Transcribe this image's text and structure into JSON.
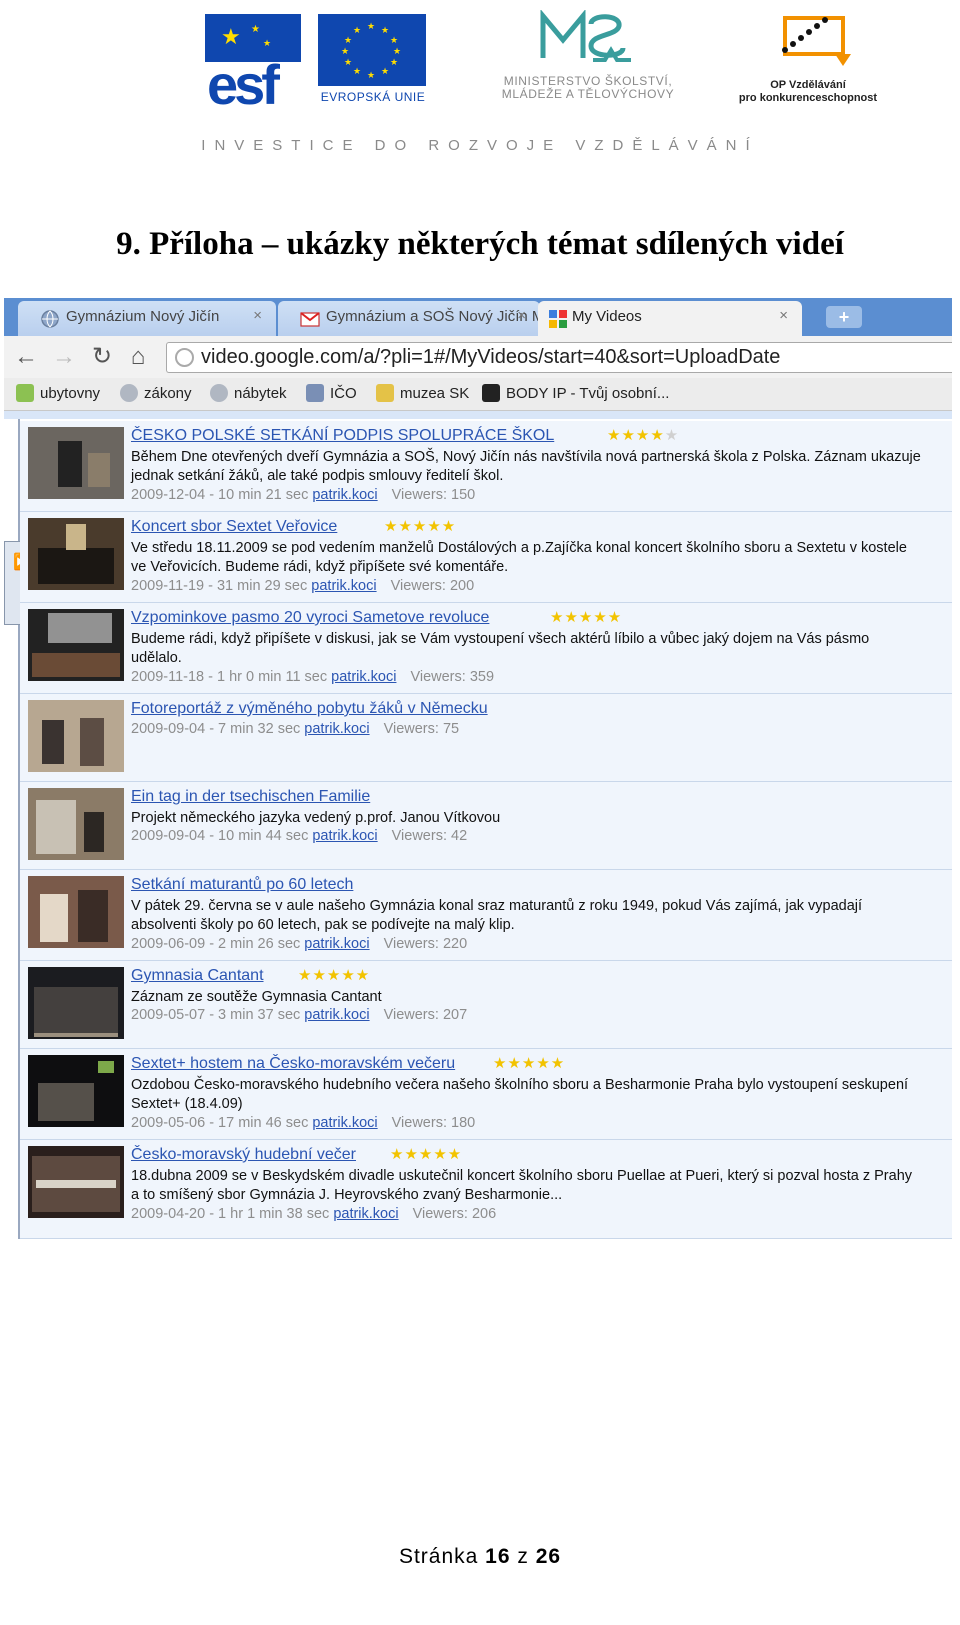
{
  "header": {
    "esf_logo_text": "esf",
    "eu_label": "EVROPSKÁ UNIE",
    "ministry_line1": "MINISTERSTVO ŠKOLSTVÍ,",
    "ministry_line2": "MLÁDEŽE A TĚLOVÝCHOVY",
    "op_line1": "OP Vzdělávání",
    "op_line2": "pro konkurenceschopnost",
    "investice": "INVESTICE DO ROZVOJE VZDĚLÁVÁNÍ"
  },
  "page_title": "9. Příloha – ukázky některých témat sdílených videí",
  "browser": {
    "tabs": [
      {
        "label": "Gymnázium Nový Jičín",
        "icon": "globe-icon",
        "active": false
      },
      {
        "label": "Gymnázium a SOŠ Nový Jičín M",
        "icon": "gmail-icon",
        "active": false
      },
      {
        "label": "My Videos",
        "icon": "google-icon",
        "active": true
      }
    ],
    "new_tab_label": "+",
    "close_label": "×",
    "url": "video.google.com/a/?pli=1#/MyVideos/start=40&sort=UploadDate",
    "bookmarks": [
      {
        "label": "ubytovny",
        "icon": "house-icon"
      },
      {
        "label": "zákony",
        "icon": "globe-icon"
      },
      {
        "label": "nábytek",
        "icon": "globe-icon"
      },
      {
        "label": "IČO",
        "icon": "building-icon"
      },
      {
        "label": "muzea SK",
        "icon": "museum-icon"
      },
      {
        "label": "BODY IP - Tvůj osobní...",
        "icon": "ip-icon"
      }
    ]
  },
  "videos": [
    {
      "title": "ČESKO POLSKÉ SETKÁNÍ PODPIS SPOLUPRÁCE ŠKOL",
      "rating": 4,
      "description": "Během Dne otevřených dveří Gymnázia a SOŠ, Nový Jičín nás navštívila nová partnerská škola z Polska. Záznam ukazuje jednak setkání žáků, ale také podpis smlouvy ředitelí škol.",
      "meta": "2009-12-04 - 10 min 21 sec",
      "author": "patrik.koci",
      "views": "Viewers: 150"
    },
    {
      "title": "Koncert sbor Sextet Veřovice",
      "rating": 5,
      "description": "Ve středu 18.11.2009 se pod vedením manželů Dostálových a p.Zajíčka konal koncert školního sboru a Sextetu v kostele ve Veřovicích. Budeme rádi, když připíšete své komentáře.",
      "meta": "2009-11-19 - 31 min 29 sec",
      "author": "patrik.koci",
      "views": "Viewers: 200"
    },
    {
      "title": "Vzpominkove pasmo 20 vyroci Sametove revoluce",
      "rating": 5,
      "description": "Budeme rádi, když připíšete v diskusi, jak se Vám vystoupení všech aktérů líbilo a vůbec jaký dojem na Vás pásmo udělalo.",
      "meta": "2009-11-18 - 1 hr 0 min 11 sec",
      "author": "patrik.koci",
      "views": "Viewers: 359"
    },
    {
      "title": "Fotoreportáž z výměného pobytu žáků v Německu",
      "rating": 0,
      "description": "",
      "meta": "2009-09-04 - 7 min 32 sec",
      "author": "patrik.koci",
      "views": "Viewers: 75"
    },
    {
      "title": "Ein tag in der tsechischen Familie",
      "rating": 0,
      "description": "Projekt německého jazyka vedený p.prof. Janou Vítkovou",
      "meta": "2009-09-04 - 10 min 44 sec",
      "author": "patrik.koci",
      "views": "Viewers: 42"
    },
    {
      "title": "Setkání maturantů po 60 letech",
      "rating": 0,
      "description": "V pátek 29. června se v aule našeho Gymnázia konal sraz maturantů z roku 1949, pokud Vás zajímá, jak vypadají absolventi školy po 60 letech, pak se podívejte na malý klip.",
      "meta": "2009-06-09 - 2 min 26 sec",
      "author": "patrik.koci",
      "views": "Viewers: 220"
    },
    {
      "title": "Gymnasia Cantant",
      "rating": 5,
      "description": "Záznam ze soutěže Gymnasia Cantant",
      "meta": "2009-05-07 - 3 min 37 sec",
      "author": "patrik.koci",
      "views": "Viewers: 207"
    },
    {
      "title": "Sextet+ hostem na Česko-moravském večeru",
      "rating": 5,
      "description": "Ozdobou Česko-moravského hudebního večera našeho školního sboru a Besharmonie Praha bylo vystoupení seskupení Sextet+ (18.4.09)",
      "meta": "2009-05-06 - 17 min 46 sec",
      "author": "patrik.koci",
      "views": "Viewers: 180"
    },
    {
      "title": "Česko-moravský hudební večer",
      "rating": 5,
      "description": "18.dubna 2009 se v Beskydském divadle uskutečnil koncert školního sboru Puellae at Pueri, který si pozval hosta z Prahy a to smíšený sbor Gymnázia J. Heyrovského zvaný Besharmonie...",
      "meta": "2009-04-20 - 1 hr 1 min 38 sec",
      "author": "patrik.koci",
      "views": "Viewers: 206"
    }
  ],
  "footer": {
    "prefix": "Stránka",
    "page": "16",
    "of": "z",
    "total": "26"
  },
  "colors": {
    "link": "#2b55b2",
    "meta": "#8d8d8d",
    "row_bg": "#f0f5fc",
    "star": "#f2c300",
    "tabbar": "#5b8ed1"
  }
}
